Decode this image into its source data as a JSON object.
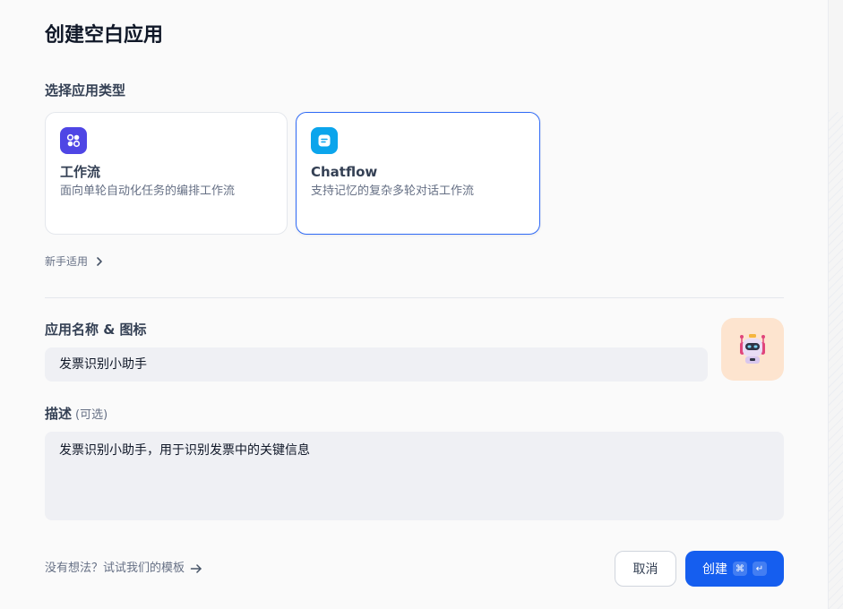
{
  "dialog": {
    "title": "创建空白应用"
  },
  "app_type": {
    "label": "选择应用类型",
    "cards": [
      {
        "name": "工作流",
        "description": "面向单轮自动化任务的编排工作流",
        "icon": "workflow-icon",
        "selected": false
      },
      {
        "name": "Chatflow",
        "description": "支持记忆的复杂多轮对话工作流",
        "icon": "chatflow-icon",
        "selected": true
      }
    ],
    "beginner_link": "新手适用"
  },
  "app_name": {
    "label": "应用名称 & 图标",
    "value": "发票识别小助手",
    "icon": "robot-icon"
  },
  "description": {
    "label": "描述",
    "optional": "(可选)",
    "value": "发票识别小助手，用于识别发票中的关键信息"
  },
  "footer": {
    "template_link": "没有想法？试试我们的模板",
    "cancel": "取消",
    "create": "创建",
    "shortcut_cmd": "⌘",
    "shortcut_enter": "↵"
  },
  "colors": {
    "accent": "#155eef",
    "workflow_icon_bg": "#4f46e5",
    "chatflow_icon_bg": "#0ba5ec"
  }
}
